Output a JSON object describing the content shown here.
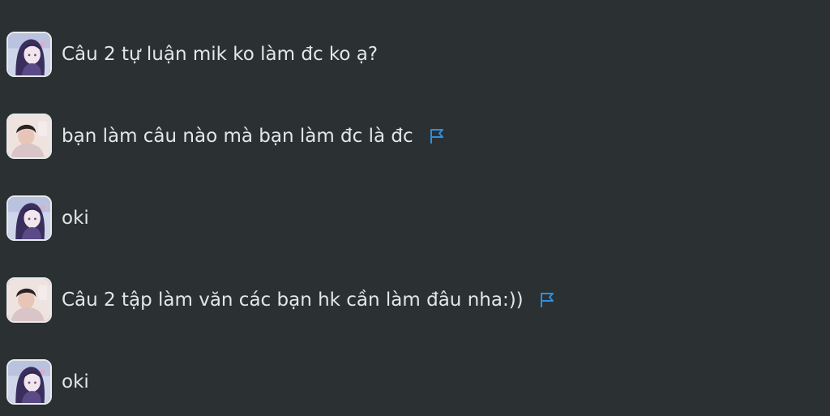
{
  "colors": {
    "background": "#2b3033",
    "text": "#e4e6e8",
    "flag": "#2f8fdf"
  },
  "messages": [
    {
      "avatar": "anime-girl-avatar",
      "text": "Câu 2 tự luận mik ko làm đc ko ạ?",
      "flag": false
    },
    {
      "avatar": "boy-photo-avatar",
      "text": "bạn làm câu nào mà bạn làm đc là đc",
      "flag": true
    },
    {
      "avatar": "anime-girl-avatar",
      "text": "oki",
      "flag": false
    },
    {
      "avatar": "boy-photo-avatar",
      "text": "Câu 2 tập làm văn các bạn hk cần làm đâu nha:))",
      "flag": true
    },
    {
      "avatar": "anime-girl-avatar",
      "text": "oki",
      "flag": false
    }
  ]
}
